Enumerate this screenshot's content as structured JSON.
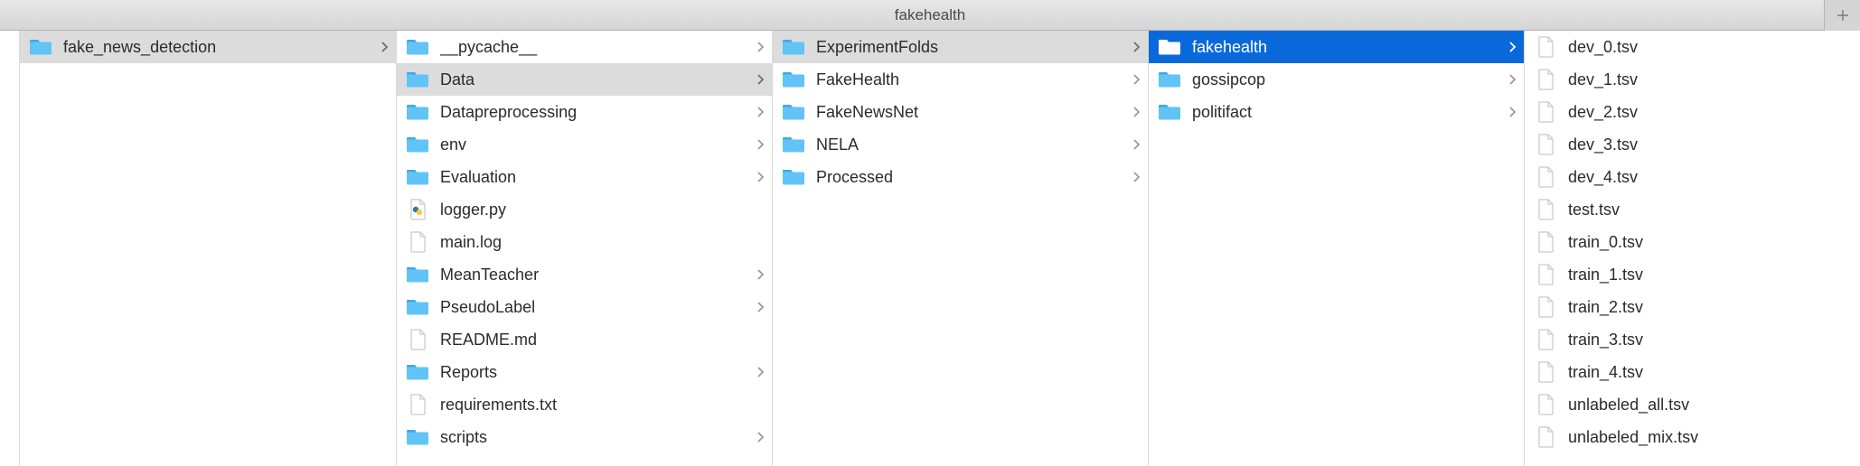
{
  "window": {
    "title": "fakehealth"
  },
  "columns": [
    {
      "items": [
        {
          "name": "fake_news_detection",
          "type": "folder",
          "expandable": true,
          "state": "path"
        }
      ]
    },
    {
      "items": [
        {
          "name": "__pycache__",
          "type": "folder",
          "expandable": true,
          "state": "normal"
        },
        {
          "name": "Data",
          "type": "folder",
          "expandable": true,
          "state": "path"
        },
        {
          "name": "Datapreprocessing",
          "type": "folder",
          "expandable": true,
          "state": "normal"
        },
        {
          "name": "env",
          "type": "folder",
          "expandable": true,
          "state": "normal"
        },
        {
          "name": "Evaluation",
          "type": "folder",
          "expandable": true,
          "state": "normal"
        },
        {
          "name": "logger.py",
          "type": "python",
          "expandable": false,
          "state": "normal"
        },
        {
          "name": "main.log",
          "type": "file",
          "expandable": false,
          "state": "normal"
        },
        {
          "name": "MeanTeacher",
          "type": "folder",
          "expandable": true,
          "state": "normal"
        },
        {
          "name": "PseudoLabel",
          "type": "folder",
          "expandable": true,
          "state": "normal"
        },
        {
          "name": "README.md",
          "type": "file",
          "expandable": false,
          "state": "normal"
        },
        {
          "name": "Reports",
          "type": "folder",
          "expandable": true,
          "state": "normal"
        },
        {
          "name": "requirements.txt",
          "type": "file",
          "expandable": false,
          "state": "normal"
        },
        {
          "name": "scripts",
          "type": "folder",
          "expandable": true,
          "state": "normal"
        }
      ]
    },
    {
      "items": [
        {
          "name": "ExperimentFolds",
          "type": "folder",
          "expandable": true,
          "state": "path"
        },
        {
          "name": "FakeHealth",
          "type": "folder",
          "expandable": true,
          "state": "normal"
        },
        {
          "name": "FakeNewsNet",
          "type": "folder",
          "expandable": true,
          "state": "normal"
        },
        {
          "name": "NELA",
          "type": "folder",
          "expandable": true,
          "state": "normal"
        },
        {
          "name": "Processed",
          "type": "folder",
          "expandable": true,
          "state": "normal"
        }
      ]
    },
    {
      "items": [
        {
          "name": "fakehealth",
          "type": "folder",
          "expandable": true,
          "state": "selected"
        },
        {
          "name": "gossipcop",
          "type": "folder",
          "expandable": true,
          "state": "normal"
        },
        {
          "name": "politifact",
          "type": "folder",
          "expandable": true,
          "state": "normal"
        }
      ]
    },
    {
      "items": [
        {
          "name": "dev_0.tsv",
          "type": "file",
          "expandable": false,
          "state": "normal"
        },
        {
          "name": "dev_1.tsv",
          "type": "file",
          "expandable": false,
          "state": "normal"
        },
        {
          "name": "dev_2.tsv",
          "type": "file",
          "expandable": false,
          "state": "normal"
        },
        {
          "name": "dev_3.tsv",
          "type": "file",
          "expandable": false,
          "state": "normal"
        },
        {
          "name": "dev_4.tsv",
          "type": "file",
          "expandable": false,
          "state": "normal"
        },
        {
          "name": "test.tsv",
          "type": "file",
          "expandable": false,
          "state": "normal"
        },
        {
          "name": "train_0.tsv",
          "type": "file",
          "expandable": false,
          "state": "normal"
        },
        {
          "name": "train_1.tsv",
          "type": "file",
          "expandable": false,
          "state": "normal"
        },
        {
          "name": "train_2.tsv",
          "type": "file",
          "expandable": false,
          "state": "normal"
        },
        {
          "name": "train_3.tsv",
          "type": "file",
          "expandable": false,
          "state": "normal"
        },
        {
          "name": "train_4.tsv",
          "type": "file",
          "expandable": false,
          "state": "normal"
        },
        {
          "name": "unlabeled_all.tsv",
          "type": "file",
          "expandable": false,
          "state": "normal"
        },
        {
          "name": "unlabeled_mix.tsv",
          "type": "file",
          "expandable": false,
          "state": "normal"
        }
      ]
    }
  ]
}
